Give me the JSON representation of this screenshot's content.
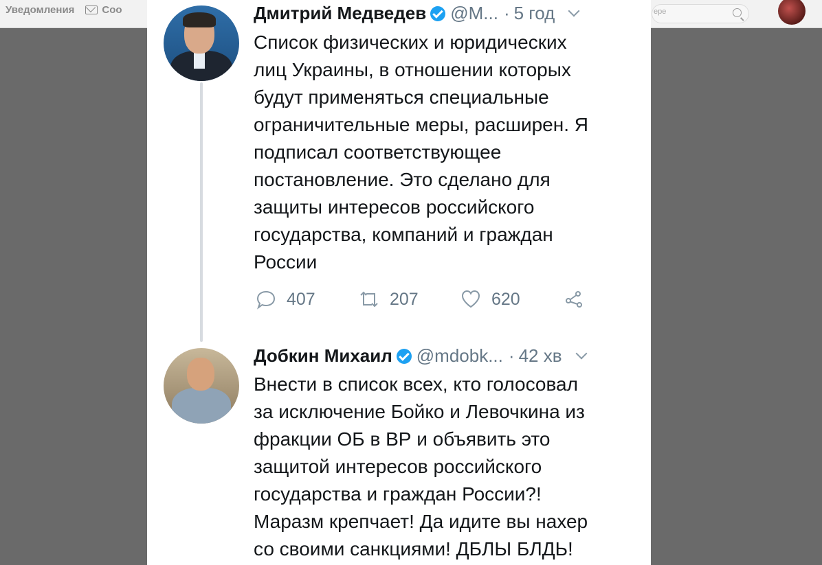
{
  "topbar": {
    "notifications_label": "Уведомления",
    "messages_label_fragment": "Соо",
    "search_fragment": "ере"
  },
  "tweets": [
    {
      "name": "Дмитрий Медведев",
      "handle": "@M...",
      "time": "5 год",
      "lines": [
        "Список физических и юридических",
        "лиц Украины, в отношении которых",
        "будут применяться специальные",
        "ограничительные меры, расширен. Я",
        "подписал соответствующее",
        "постановление. Это сделано для",
        "защиты интересов российского",
        "государства, компаний и граждан",
        "России"
      ],
      "replies": "407",
      "retweets": "207",
      "likes": "620"
    },
    {
      "name": "Добкин Михаил",
      "handle": "@mdobk...",
      "time": "42 хв",
      "lines": [
        "Внести в список всех, кто голосовал",
        "за исключение Бойко и Левочкина из",
        "фракции ОБ в ВР и объявить это",
        "защитой интересов российского",
        "государства и граждан России?!",
        "Маразм крепчает! Да идите вы нахер",
        "со своими санкциями! ДБЛЫ БЛДЬ!"
      ]
    }
  ],
  "icons": {
    "verified": "verified-badge-icon",
    "reply": "reply-icon",
    "retweet": "retweet-icon",
    "like": "heart-icon",
    "share": "share-icon",
    "menu": "chevron-down-icon"
  },
  "colors": {
    "verified": "#1da1f2",
    "secondary_text": "#657786",
    "backdrop": "#6a6a6a"
  }
}
